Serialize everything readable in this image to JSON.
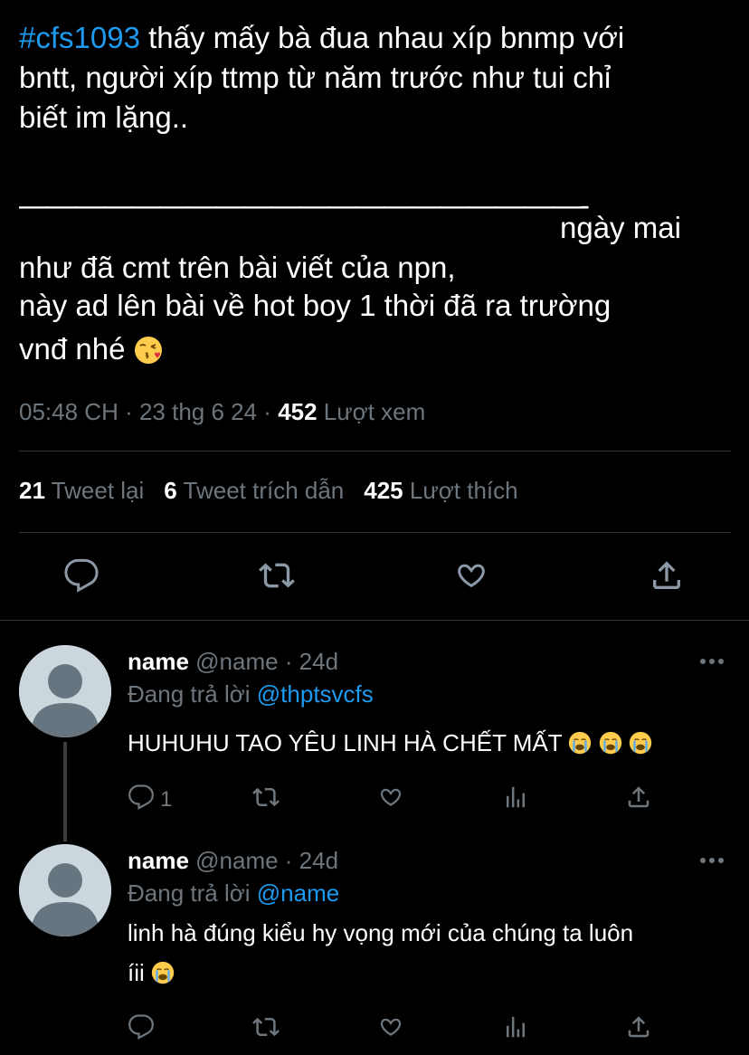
{
  "post": {
    "hashtag": "#cfs1093",
    "line1_rest": " thấy mấy bà đua nhau xíp bnmp với",
    "line2": "bntt, người xíp ttmp từ năm trước như tui chỉ",
    "line3": "biết im lặng..",
    "divider": "————————————————————-",
    "line4": "ngày mai",
    "line5": "như đã cmt trên bài viết của npn,",
    "line6": "này ad lên bài về hot boy 1 thời đã ra trường",
    "line7": "vnđ nhé",
    "emoji_name": "kissing-face-emoji"
  },
  "meta": {
    "time": "05:48 CH",
    "sep1": " · ",
    "date": "23 thg 6 24",
    "sep2": " · ",
    "views_count": "452",
    "views_label": " Lượt xem"
  },
  "stats": {
    "retweets_count": "21",
    "retweets_label": " Tweet lại",
    "quotes_count": "6",
    "quotes_label": " Tweet trích dẫn",
    "likes_count": "425",
    "likes_label": " Lượt thích"
  },
  "actions": [
    "reply-icon",
    "retweet-icon",
    "like-icon",
    "share-icon"
  ],
  "replies": [
    {
      "name": "name",
      "handle": " @name · 24d",
      "replying_label": "Đang trả lời ",
      "replying_to": "@thptsvcfs",
      "text": "HUHUHU TAO YÊU LINH HÀ CHẾT MẤT",
      "text2": "",
      "reply_count": "1",
      "emoji_name": "loudly-crying-face-emoji"
    },
    {
      "name": "name",
      "handle": " @name · 24d",
      "replying_label": "Đang trả lời ",
      "replying_to": "@name",
      "text": "linh hà đúng kiểu hy vọng mới của chúng ta luôn",
      "text2": "íii",
      "reply_count": "",
      "emoji_name": "loudly-crying-face-emoji"
    }
  ],
  "colors": {
    "background": "#000000",
    "accent": "#1d9bf0",
    "muted": "#6e767d",
    "divider": "#2f3336"
  }
}
